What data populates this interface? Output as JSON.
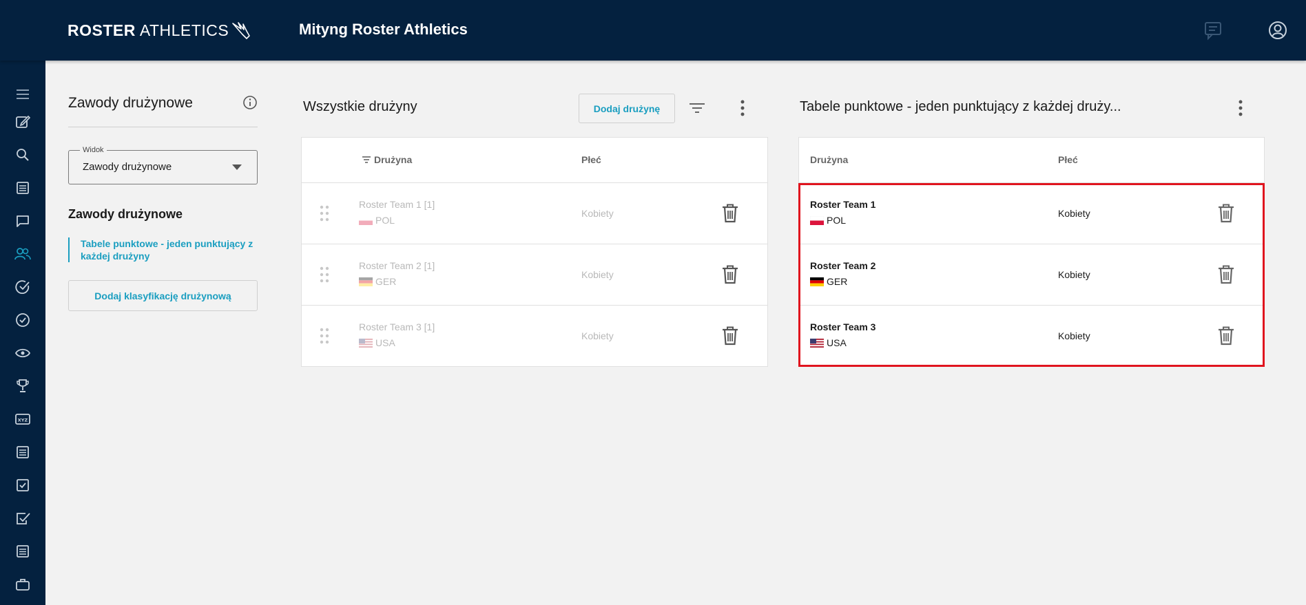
{
  "header": {
    "logo_bold": "ROSTER",
    "logo_light": "ATHLETICS",
    "title": "Mityng Roster Athletics"
  },
  "rail": {
    "icons": [
      "menu-icon",
      "edit-icon",
      "search-icon",
      "list-icon",
      "chat-icon",
      "people-icon",
      "check-circle-icon",
      "check-circle-icon",
      "eye-icon",
      "trophy-icon",
      "xyz-icon",
      "list-icon",
      "checkbox-icon",
      "checklist-icon",
      "list-icon",
      "briefcase-icon"
    ],
    "active_index": 5,
    "accent": "#1a9ec0"
  },
  "side": {
    "title": "Zawody drużynowe",
    "select_label": "Widok",
    "select_value": "Zawody drużynowe",
    "heading": "Zawody drużynowe",
    "link": "Tabele punktowe - jeden punktujący z każdej drużyny",
    "add_button": "Dodaj klasyfikację drużynową"
  },
  "middle": {
    "title": "Wszystkie drużyny",
    "add_button": "Dodaj drużynę",
    "columns": {
      "team": "Drużyna",
      "gender": "Płeć"
    },
    "rows": [
      {
        "name": "Roster Team 1 [1]",
        "country": "POL",
        "gender": "Kobiety"
      },
      {
        "name": "Roster Team 2 [1]",
        "country": "GER",
        "gender": "Kobiety"
      },
      {
        "name": "Roster Team 3 [1]",
        "country": "USA",
        "gender": "Kobiety"
      }
    ]
  },
  "right": {
    "title": "Tabele punktowe - jeden punktujący z każdej druży...",
    "columns": {
      "team": "Drużyna",
      "gender": "Płeć"
    },
    "rows": [
      {
        "name": "Roster Team 1",
        "country": "POL",
        "gender": "Kobiety"
      },
      {
        "name": "Roster Team 2",
        "country": "GER",
        "gender": "Kobiety"
      },
      {
        "name": "Roster Team 3",
        "country": "USA",
        "gender": "Kobiety"
      }
    ],
    "highlight_color": "#e0141e"
  }
}
